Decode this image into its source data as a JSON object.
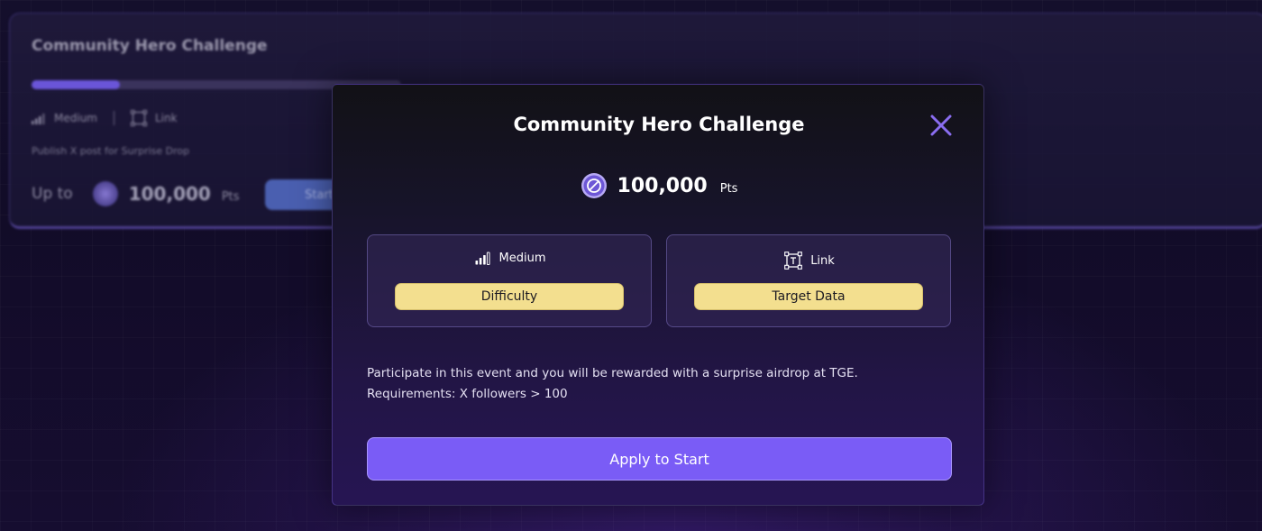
{
  "background_card": {
    "title": "Community Hero Challenge",
    "progress_fraction": 0.24,
    "difficulty": "Medium",
    "target": "Link",
    "description": "Publish X post for Surprise Drop",
    "reward_prefix": "Up to",
    "reward_value": "100,000",
    "reward_unit": "Pts",
    "start_label": "Start"
  },
  "modal": {
    "title": "Community Hero Challenge",
    "close_icon": "close-icon",
    "points_value": "100,000",
    "points_unit": "Pts",
    "difficulty_card": {
      "icon": "signal-bars-icon",
      "value": "Medium",
      "label": "Difficulty"
    },
    "target_card": {
      "icon": "text-box-icon",
      "value": "Link",
      "label": "Target Data"
    },
    "description_line1": "Participate in this event and you will be rewarded with a surprise airdrop at TGE.",
    "description_line2": "Requirements: X followers > 100",
    "apply_label": "Apply to Start"
  },
  "colors": {
    "accent": "#7a5cf6",
    "pill": "#f3df8f",
    "close": "#8a6df0"
  }
}
